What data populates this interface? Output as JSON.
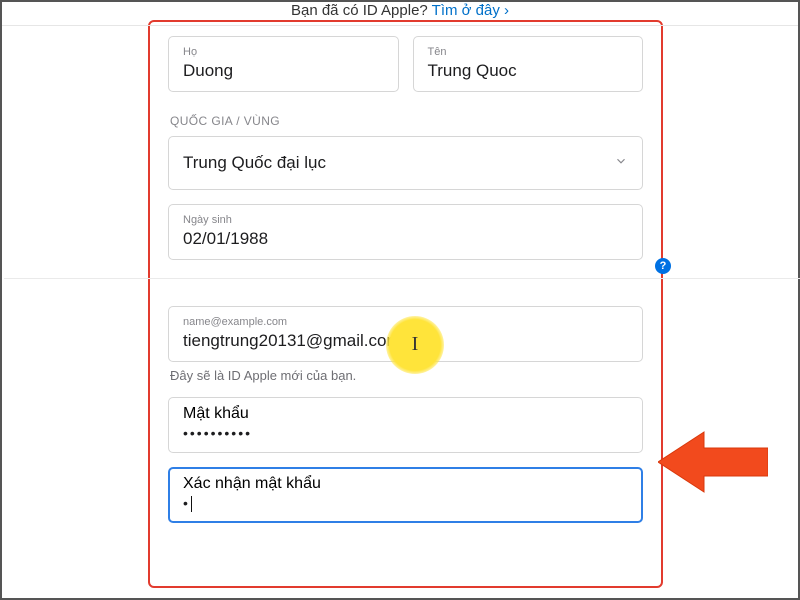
{
  "top": {
    "prompt": "Bạn đã có ID Apple? ",
    "link": "Tìm ở đây ›"
  },
  "name": {
    "last_label": "Họ",
    "last_value": "Duong",
    "first_label": "Tên",
    "first_value": "Trung Quoc"
  },
  "region": {
    "section_label": "QUỐC GIA / VÙNG",
    "selected": "Trung Quốc đại lục"
  },
  "birth": {
    "label": "Ngày sinh",
    "value": "02/01/1988"
  },
  "email": {
    "placeholder": "name@example.com",
    "value": "tiengtrung20131@gmail.com",
    "hint": "Đây sẽ là ID Apple mới của bạn."
  },
  "password": {
    "label": "Mật khẩu",
    "masked": "••••••••••"
  },
  "confirm": {
    "label": "Xác nhận mật khẩu",
    "masked": "•"
  },
  "help_badge": "?",
  "colors": {
    "accent": "#0070c9",
    "highlight_red": "#e23b2e"
  }
}
